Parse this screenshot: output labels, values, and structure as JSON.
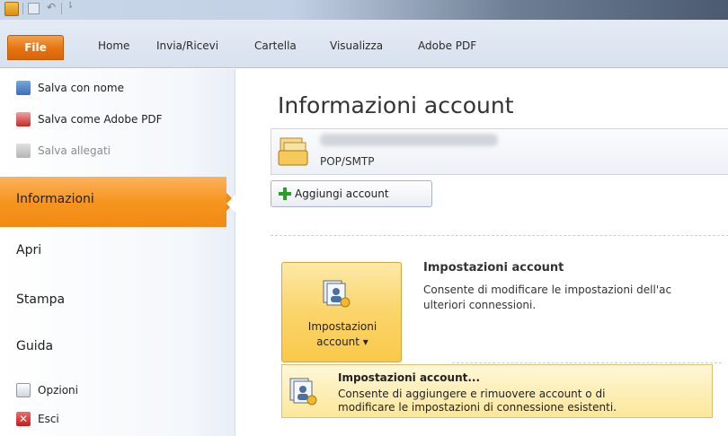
{
  "ribbon": {
    "file_tab": "File",
    "tabs": [
      "Home",
      "Invia/Ricevi",
      "Cartella",
      "Visualizza",
      "Adobe PDF"
    ]
  },
  "left": {
    "commands": [
      {
        "label": "Salva con nome",
        "icon": "save-as-icon",
        "enabled": true
      },
      {
        "label": "Salva come Adobe PDF",
        "icon": "adobe-pdf-icon",
        "enabled": true
      },
      {
        "label": "Salva allegati",
        "icon": "save-attachments-icon",
        "enabled": false
      }
    ],
    "nav": {
      "selected": "Informazioni",
      "items": [
        "Apri",
        "Stampa",
        "Guida"
      ]
    },
    "bottom": [
      {
        "label": "Opzioni",
        "icon": "options-icon"
      },
      {
        "label": "Esci",
        "icon": "exit-icon"
      }
    ]
  },
  "main": {
    "title": "Informazioni account",
    "account_type": "POP/SMTP",
    "add_account": "Aggiungi account",
    "settings_button": {
      "line1": "Impostazioni",
      "line2": "account ▾"
    },
    "section_title": "Impostazioni account",
    "section_desc_line1": "Consente di modificare le impostazioni dell'ac",
    "section_desc_line2": "ulteriori connessioni.",
    "dropdown_item": {
      "title": "Impostazioni account...",
      "desc_line1": "Consente di aggiungere e rimuovere account o di",
      "desc_line2": "modificare le impostazioni di connessione esistenti."
    }
  },
  "colors": {
    "accent_orange": "#f08a12",
    "highlight_yellow": "#fbd46a"
  }
}
